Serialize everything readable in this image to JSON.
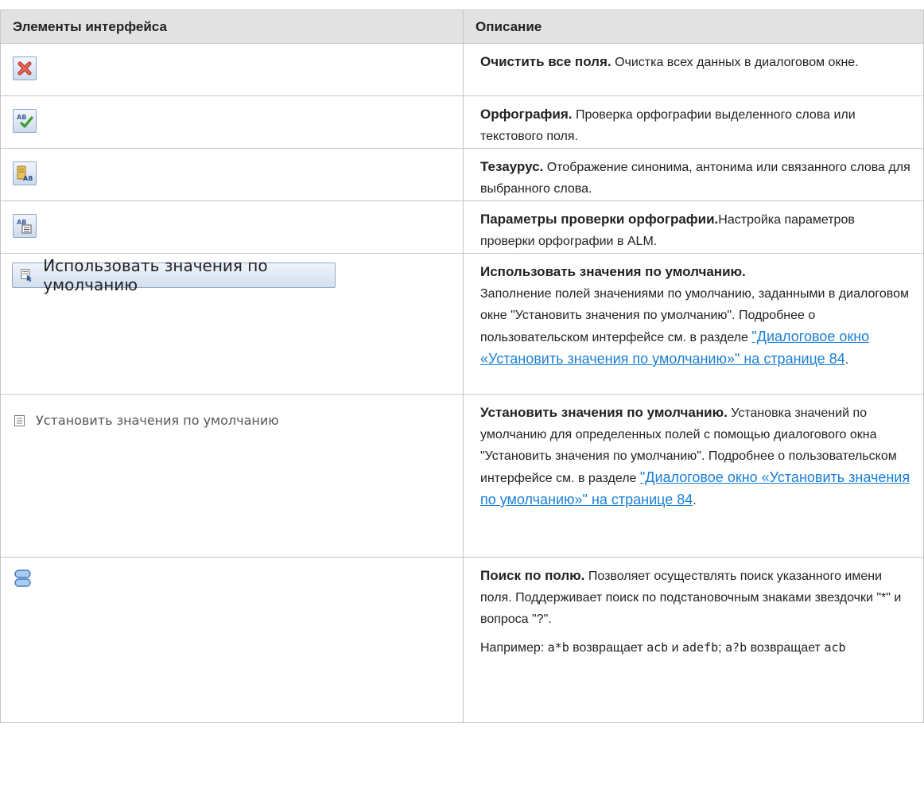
{
  "header": {
    "col_elements": "Элементы интерфейса",
    "col_description": "Описание"
  },
  "rows": [
    {
      "icon": "clear-fields-icon",
      "title": "Очистить все поля.",
      "text": "Очистка всех данных в диалоговом окне."
    },
    {
      "icon": "spelling-icon",
      "title": "Орфография.",
      "text": "Проверка орфографии выделенного слова или текстового поля."
    },
    {
      "icon": "thesaurus-icon",
      "title": "Тезаурус.",
      "text": "Отображение синонима, антонима или связанного слова для выбранного слова."
    },
    {
      "icon": "spelling-options-icon",
      "title": "Параметры проверки орфографии.",
      "text": "Настройка параметров проверки орфографии в ALM."
    },
    {
      "button_label": "Использовать значения по умолчанию",
      "title": "Использовать значения по умолчанию.",
      "text": "Заполнение полей значениями по умолчанию, заданными в диалоговом окне \"Установить значения по умолчанию\". Подробнее о пользовательском интерфейсе см. в разделе ",
      "link": "\"Диалоговое окно «Установить значения по умолчанию»\" на странице 84",
      "tail": "."
    },
    {
      "button_label": "Установить значения по умолчанию",
      "title": "Установить значения по умолчанию.",
      "text": "Установка значений по умолчанию для определенных полей с помощью диалогового окна \"Установить значения по умолчанию\". Подробнее о пользовательском интерфейсе см. в разделе ",
      "link": "\"Диалоговое окно «Установить значения по умолчанию»\" на странице 84",
      "tail": "."
    },
    {
      "icon": "field-search-icon",
      "title": "Поиск по полю.",
      "text": "Позволяет осуществлять поиск указанного имени поля. Поддерживает поиск по подстановочным знаками звездочки \"*\" и вопроса \"?\".",
      "example": {
        "p1": "Например: ",
        "c1": "a*b",
        "p2": " возвращает ",
        "c2": "acb",
        "p3": " и ",
        "c3": "adefb",
        "p4": "; ",
        "c4": "a?b",
        "p5": " возвращает ",
        "c5": "acb"
      }
    }
  ],
  "colors": {
    "header_bg": "#e2e2e2",
    "border": "#c6c6c6",
    "link": "#1a7fd6"
  }
}
